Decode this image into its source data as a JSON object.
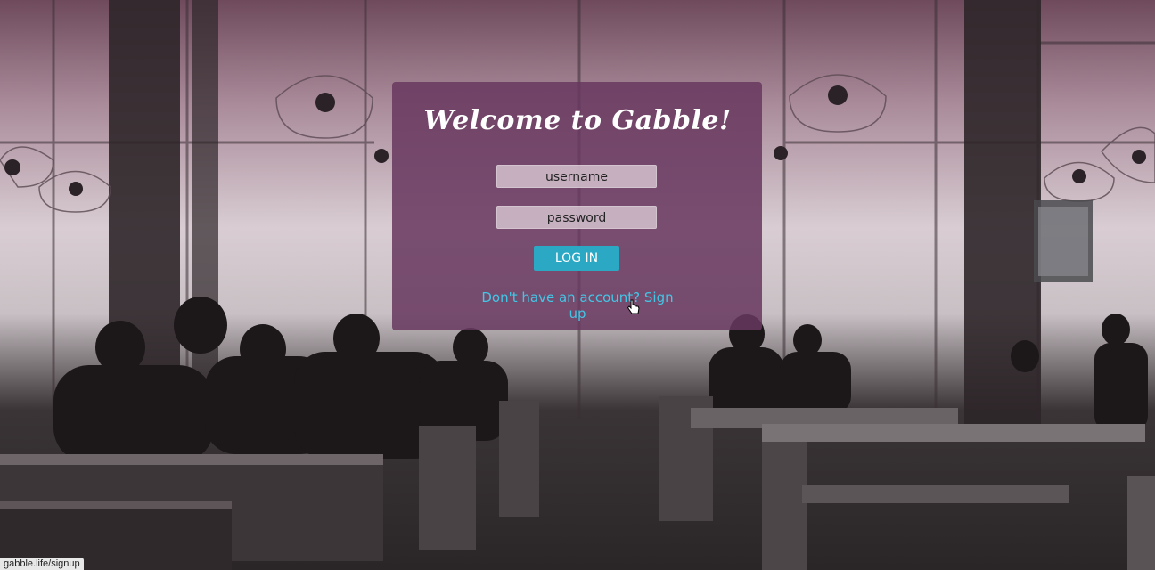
{
  "login": {
    "title": "Welcome to Gabble!",
    "username_placeholder": "username",
    "password_placeholder": "password",
    "login_button": "LOG IN",
    "signup_link": "Don't have an account? Sign up"
  },
  "status_bar": {
    "url": "gabble.life/signup"
  },
  "colors": {
    "panel": "#683860",
    "button": "#2aa8c4",
    "link": "#43c6e6"
  }
}
